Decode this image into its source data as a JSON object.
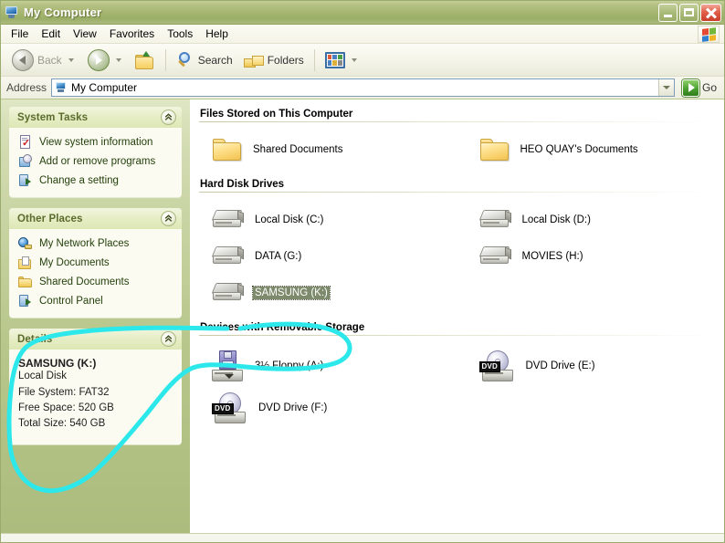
{
  "window": {
    "title": "My Computer",
    "title_icon": "my-computer-icon",
    "controls": {
      "minimize": "Minimize",
      "maximize": "Maximize",
      "close": "Close"
    }
  },
  "menu": {
    "items": [
      {
        "label": "File"
      },
      {
        "label": "Edit"
      },
      {
        "label": "View"
      },
      {
        "label": "Favorites"
      },
      {
        "label": "Tools"
      },
      {
        "label": "Help"
      }
    ],
    "flag_icon": "windows-flag-icon"
  },
  "toolbar": {
    "back_label": "Back",
    "forward_label": "",
    "up_label": "",
    "search_label": "Search",
    "folders_label": "Folders",
    "views_label": ""
  },
  "address": {
    "label": "Address",
    "value": "My Computer",
    "go_label": "Go"
  },
  "sidebar": {
    "panels": [
      {
        "title": "System Tasks",
        "collapse_icon": "chevron-up-icon",
        "items": [
          {
            "label": "View system information",
            "icon": "system-info-icon"
          },
          {
            "label": "Add or remove programs",
            "icon": "add-remove-programs-icon"
          },
          {
            "label": "Change a setting",
            "icon": "change-setting-icon"
          }
        ]
      },
      {
        "title": "Other Places",
        "collapse_icon": "chevron-up-icon",
        "items": [
          {
            "label": "My Network Places",
            "icon": "network-places-icon"
          },
          {
            "label": "My Documents",
            "icon": "my-documents-icon"
          },
          {
            "label": "Shared Documents",
            "icon": "shared-documents-icon"
          },
          {
            "label": "Control Panel",
            "icon": "control-panel-icon"
          }
        ]
      }
    ],
    "details": {
      "title": "Details",
      "collapse_icon": "chevron-up-icon",
      "name": "SAMSUNG (K:)",
      "type": "Local Disk",
      "file_system": "File System: FAT32",
      "free_space": "Free Space: 520 GB",
      "total_size": "Total Size: 540 GB"
    }
  },
  "content": {
    "groups": [
      {
        "heading": "Files Stored on This Computer",
        "items": [
          {
            "label": "Shared Documents",
            "icon": "folder-icon",
            "selected": false
          },
          {
            "label": "HEO QUAY's Documents",
            "icon": "folder-icon",
            "selected": false
          }
        ]
      },
      {
        "heading": "Hard Disk Drives",
        "items": [
          {
            "label": "Local Disk (C:)",
            "icon": "hard-drive-icon",
            "selected": false
          },
          {
            "label": "Local Disk (D:)",
            "icon": "hard-drive-icon",
            "selected": false
          },
          {
            "label": "DATA (G:)",
            "icon": "hard-drive-icon",
            "selected": false
          },
          {
            "label": "MOVIES (H:)",
            "icon": "hard-drive-icon",
            "selected": false
          },
          {
            "label": "SAMSUNG (K:)",
            "icon": "hard-drive-icon",
            "selected": true
          }
        ]
      },
      {
        "heading": "Devices with Removable Storage",
        "items": [
          {
            "label": "3½ Floppy (A:)",
            "icon": "floppy-drive-icon",
            "selected": false
          },
          {
            "label": "DVD Drive (E:)",
            "icon": "dvd-drive-icon",
            "badge": "DVD",
            "selected": false
          },
          {
            "label": "DVD Drive (F:)",
            "icon": "dvd-drive-icon",
            "badge": "DVD",
            "selected": false
          }
        ]
      }
    ]
  },
  "annotation": {
    "type": "freehand-circle",
    "color": "#2ce8ea",
    "stroke_width": 5,
    "description": "Hand-drawn cyan loop encircling the selected SAMSUNG (K:) drive and the Details panel"
  }
}
